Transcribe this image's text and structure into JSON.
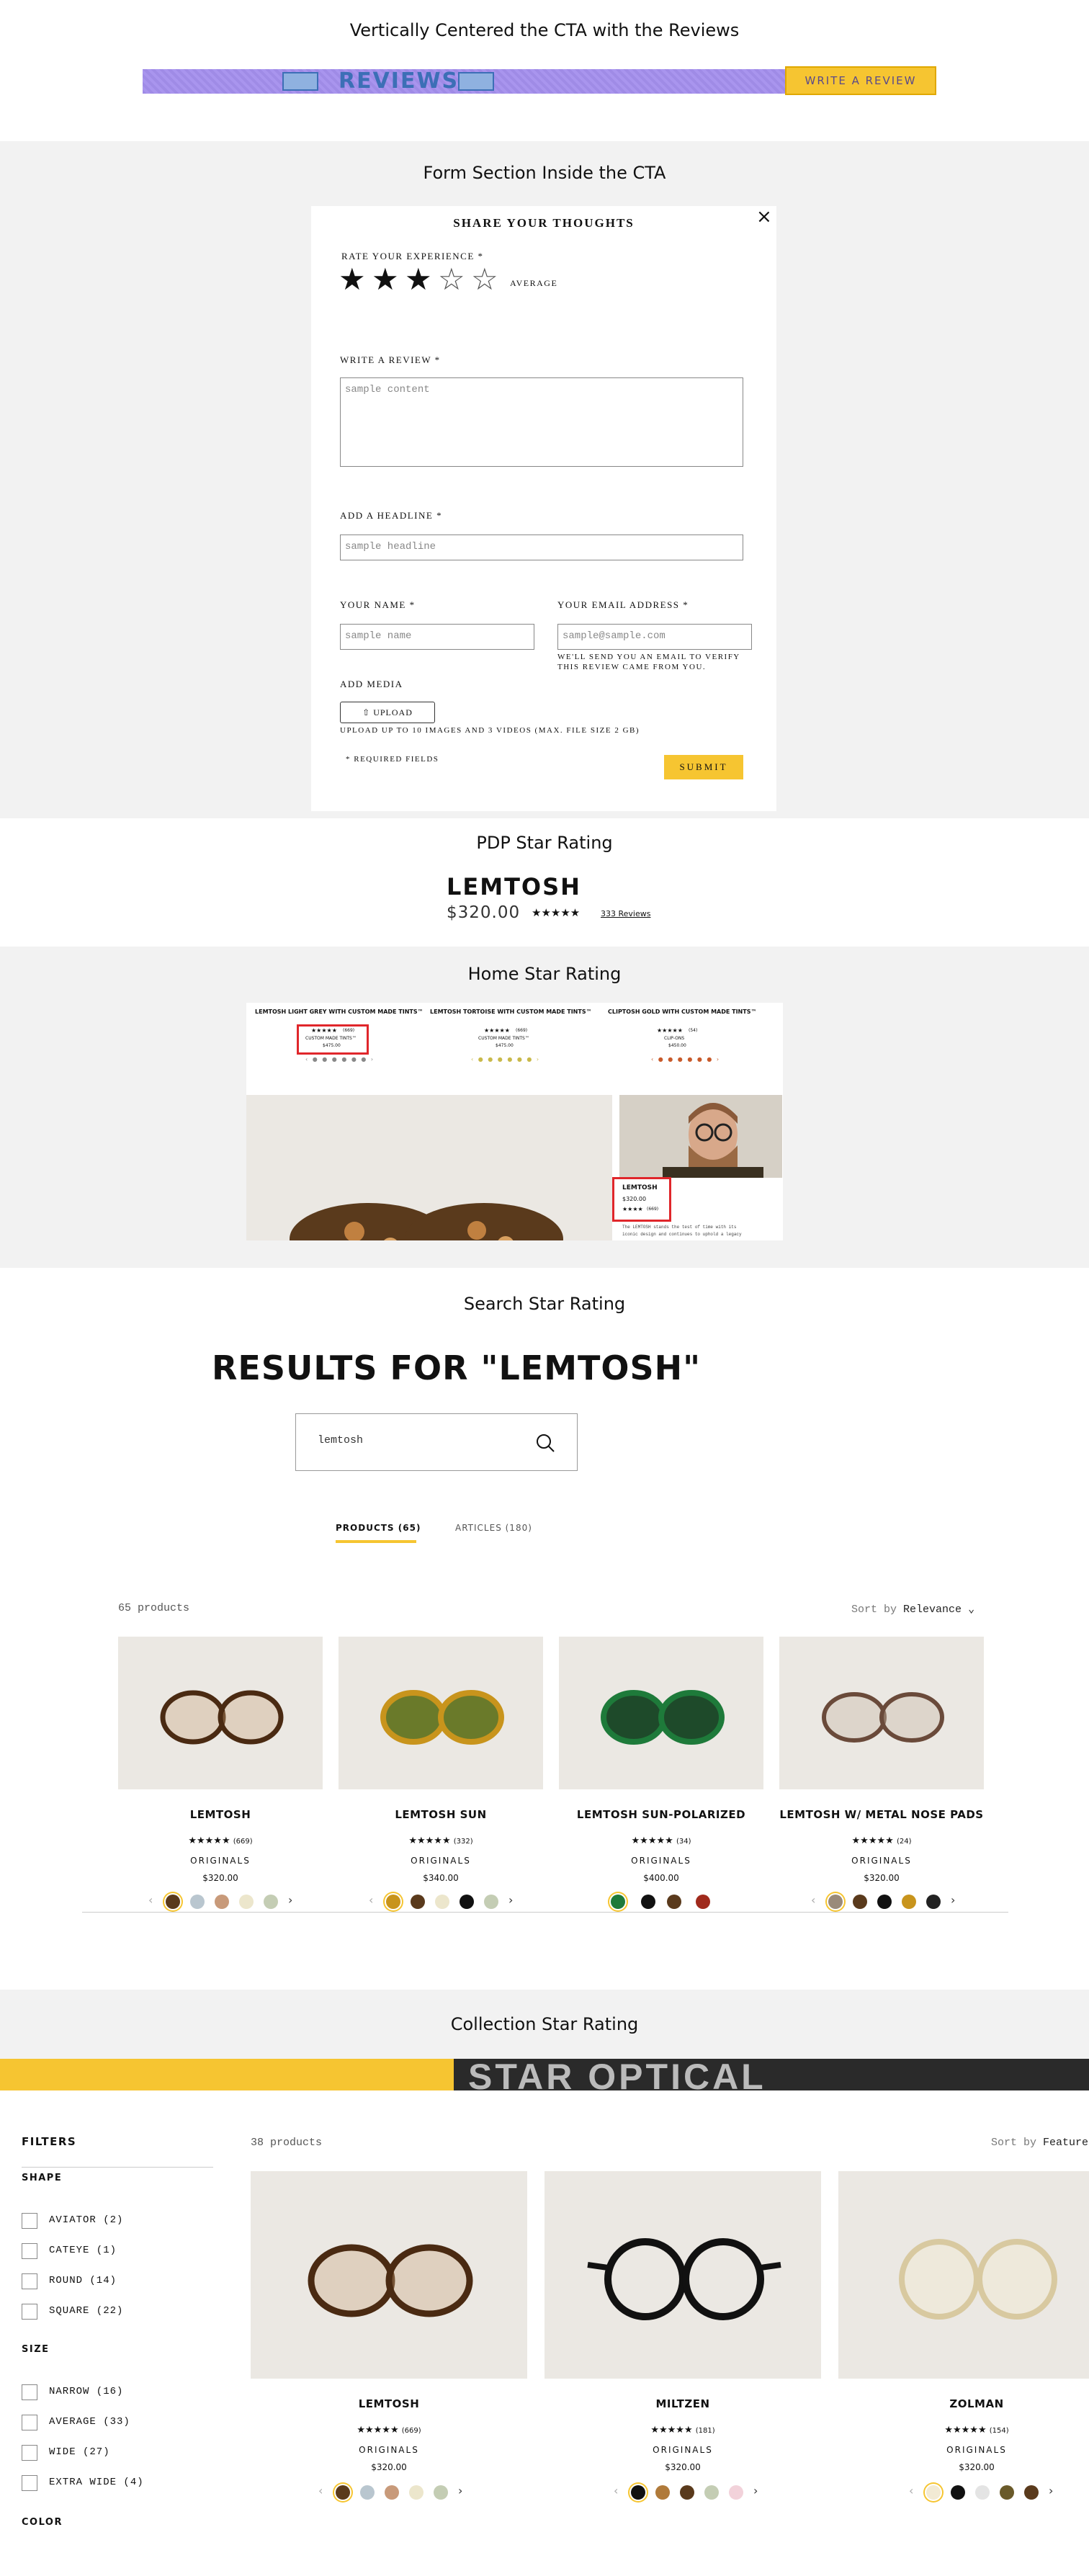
{
  "sections": {
    "cta_title": "Vertically Centered the CTA with the Reviews",
    "form_title": "Form Section Inside the CTA",
    "pdp_title": "PDP Star Rating",
    "home_title": "Home Star Rating",
    "search_title": "Search Star Rating",
    "collection_title": "Collection Star Rating"
  },
  "cta": {
    "reviews": "REVIEWS",
    "write_review": "WRITE A REVIEW"
  },
  "form": {
    "heading": "SHARE YOUR THOUGHTS",
    "close": "×",
    "rate_label": "RATE YOUR EXPERIENCE *",
    "rating": 3,
    "rating_max": 5,
    "rating_text": "AVERAGE",
    "review_label": "WRITE A REVIEW *",
    "review_placeholder": "sample content",
    "headline_label": "ADD A HEADLINE *",
    "headline_placeholder": "sample headline",
    "name_label": "YOUR NAME *",
    "name_placeholder": "sample name",
    "email_label": "YOUR EMAIL ADDRESS *",
    "email_placeholder": "sample@sample.com",
    "email_note_1": "WE'LL SEND YOU AN EMAIL TO VERIFY",
    "email_note_2": "THIS REVIEW CAME FROM YOU.",
    "media_label": "ADD MEDIA",
    "upload": "UPLOAD",
    "upload_note": "UPLOAD UP TO 10 IMAGES AND 3 VIDEOS (MAX. FILE SIZE 2 GB)",
    "required": "* REQUIRED FIELDS",
    "submit": "SUBMIT"
  },
  "pdp": {
    "name": "LEMTOSH",
    "price": "$320.00",
    "stars": "★★★★★",
    "reviews": "333 Reviews"
  },
  "home": {
    "cards": [
      {
        "title": "LEMTOSH LIGHT GREY WITH CUSTOM MADE TINTS™",
        "stars": "★★★★★",
        "count": "(669)",
        "sub": "CUSTOM MADE TINTS™",
        "price": "$475.00"
      },
      {
        "title": "LEMTOSH TORTOISE WITH CUSTOM MADE TINTS™",
        "stars": "★★★★★",
        "count": "(669)",
        "sub": "CUSTOM MADE TINTS™",
        "price": "$475.00"
      },
      {
        "title": "CLIPTOSH GOLD WITH CUSTOM MADE TINTS™",
        "stars": "★★★★★",
        "count": "(54)",
        "sub": "CLIP-ONS",
        "price": "$450.00"
      }
    ],
    "feature": {
      "name": "LEMTOSH",
      "price": "$320.00",
      "stars": "★★★★",
      "count": "(669)",
      "desc_1": "The LEMTOSH stands the test of time with its",
      "desc_2": "iconic design and continues to uphold a legacy"
    }
  },
  "search": {
    "heading": "RESULTS FOR \"LEMTOSH\"",
    "query": "lemtosh",
    "tab_products": "PRODUCTS (65)",
    "tab_articles": "ARTICLES (180)",
    "count": "65 products",
    "sort_label": "Sort by",
    "sort_value": "Relevance",
    "products": [
      {
        "name": "LEMTOSH",
        "stars": "★★★★★",
        "count": "(669)",
        "sub": "ORIGINALS",
        "price": "$320.00"
      },
      {
        "name": "LEMTOSH SUN",
        "stars": "★★★★★",
        "count": "(332)",
        "sub": "ORIGINALS",
        "price": "$340.00"
      },
      {
        "name": "LEMTOSH SUN-POLARIZED",
        "stars": "★★★★★",
        "count": "(34)",
        "sub": "ORIGINALS",
        "price": "$400.00"
      },
      {
        "name": "LEMTOSH W/ METAL NOSE PADS",
        "stars": "★★★★★",
        "count": "(24)",
        "sub": "ORIGINALS",
        "price": "$320.00"
      }
    ]
  },
  "collection": {
    "banner_text": "STAR OPTICAL",
    "filters_title": "FILTERS",
    "shape_title": "SHAPE",
    "shapes": [
      "AVIATOR (2)",
      "CATEYE (1)",
      "ROUND (14)",
      "SQUARE (22)"
    ],
    "size_title": "SIZE",
    "sizes": [
      "NARROW (16)",
      "AVERAGE (33)",
      "WIDE (27)",
      "EXTRA WIDE (4)"
    ],
    "color_title": "COLOR",
    "count": "38 products",
    "sort_label": "Sort by",
    "sort_value": "Featured",
    "products": [
      {
        "name": "LEMTOSH",
        "stars": "★★★★★",
        "count": "(669)",
        "sub": "ORIGINALS",
        "price": "$320.00"
      },
      {
        "name": "MILTZEN",
        "stars": "★★★★★",
        "count": "(181)",
        "sub": "ORIGINALS",
        "price": "$320.00"
      },
      {
        "name": "ZOLMAN",
        "stars": "★★★★★",
        "count": "(154)",
        "sub": "ORIGINALS",
        "price": "$320.00"
      }
    ]
  },
  "colors": {
    "accent": "#f6c531",
    "band": "#f2f2f2",
    "highlight": "#e0262b",
    "purple": "#9f8be6"
  }
}
